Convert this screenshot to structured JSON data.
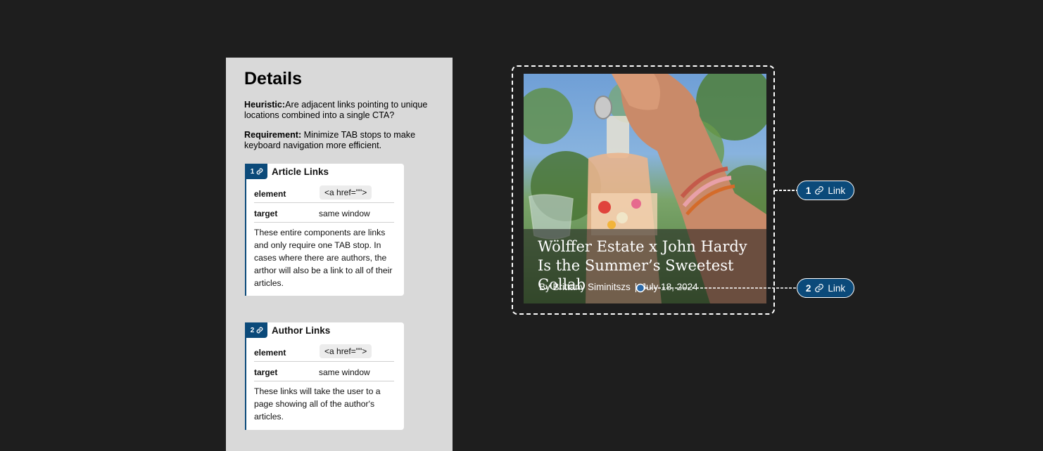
{
  "details": {
    "title": "Details",
    "heuristic_label": "Heuristic:",
    "heuristic_text": "Are adjacent links pointing to unique locations combined into a single CTA?",
    "requirement_label": "Requirement:",
    "requirement_text": " Minimize TAB stops to make keyboard navigation more efficient.",
    "cards": [
      {
        "number": "1",
        "title": "Article Links",
        "element_label": "element",
        "element_value": "<a href=\"\">",
        "target_label": "target",
        "target_value": "same window",
        "description": "These entire components are links and only require one TAB stop. In cases where there are authors, the arthor will also be a link to all of their articles."
      },
      {
        "number": "2",
        "title": "Author Links",
        "element_label": "element",
        "element_value": "<a href=\"\">",
        "target_label": "target",
        "target_value": "same window",
        "description": "These links will take the user to a page showing all of the author's articles."
      }
    ]
  },
  "article": {
    "headline": "Wölffer Estate x John Hardy Is the Summer’s Sweetest Collab",
    "author": "By Brittany Siminitszs",
    "separator": "|",
    "date": "July 18, 2024"
  },
  "callouts": [
    {
      "number": "1",
      "label": "Link"
    },
    {
      "number": "2",
      "label": "Link"
    }
  ],
  "colors": {
    "background": "#1e1e1e",
    "panel": "#d9d9d9",
    "accent": "#0b4a7a"
  },
  "icons": [
    "link-icon"
  ]
}
